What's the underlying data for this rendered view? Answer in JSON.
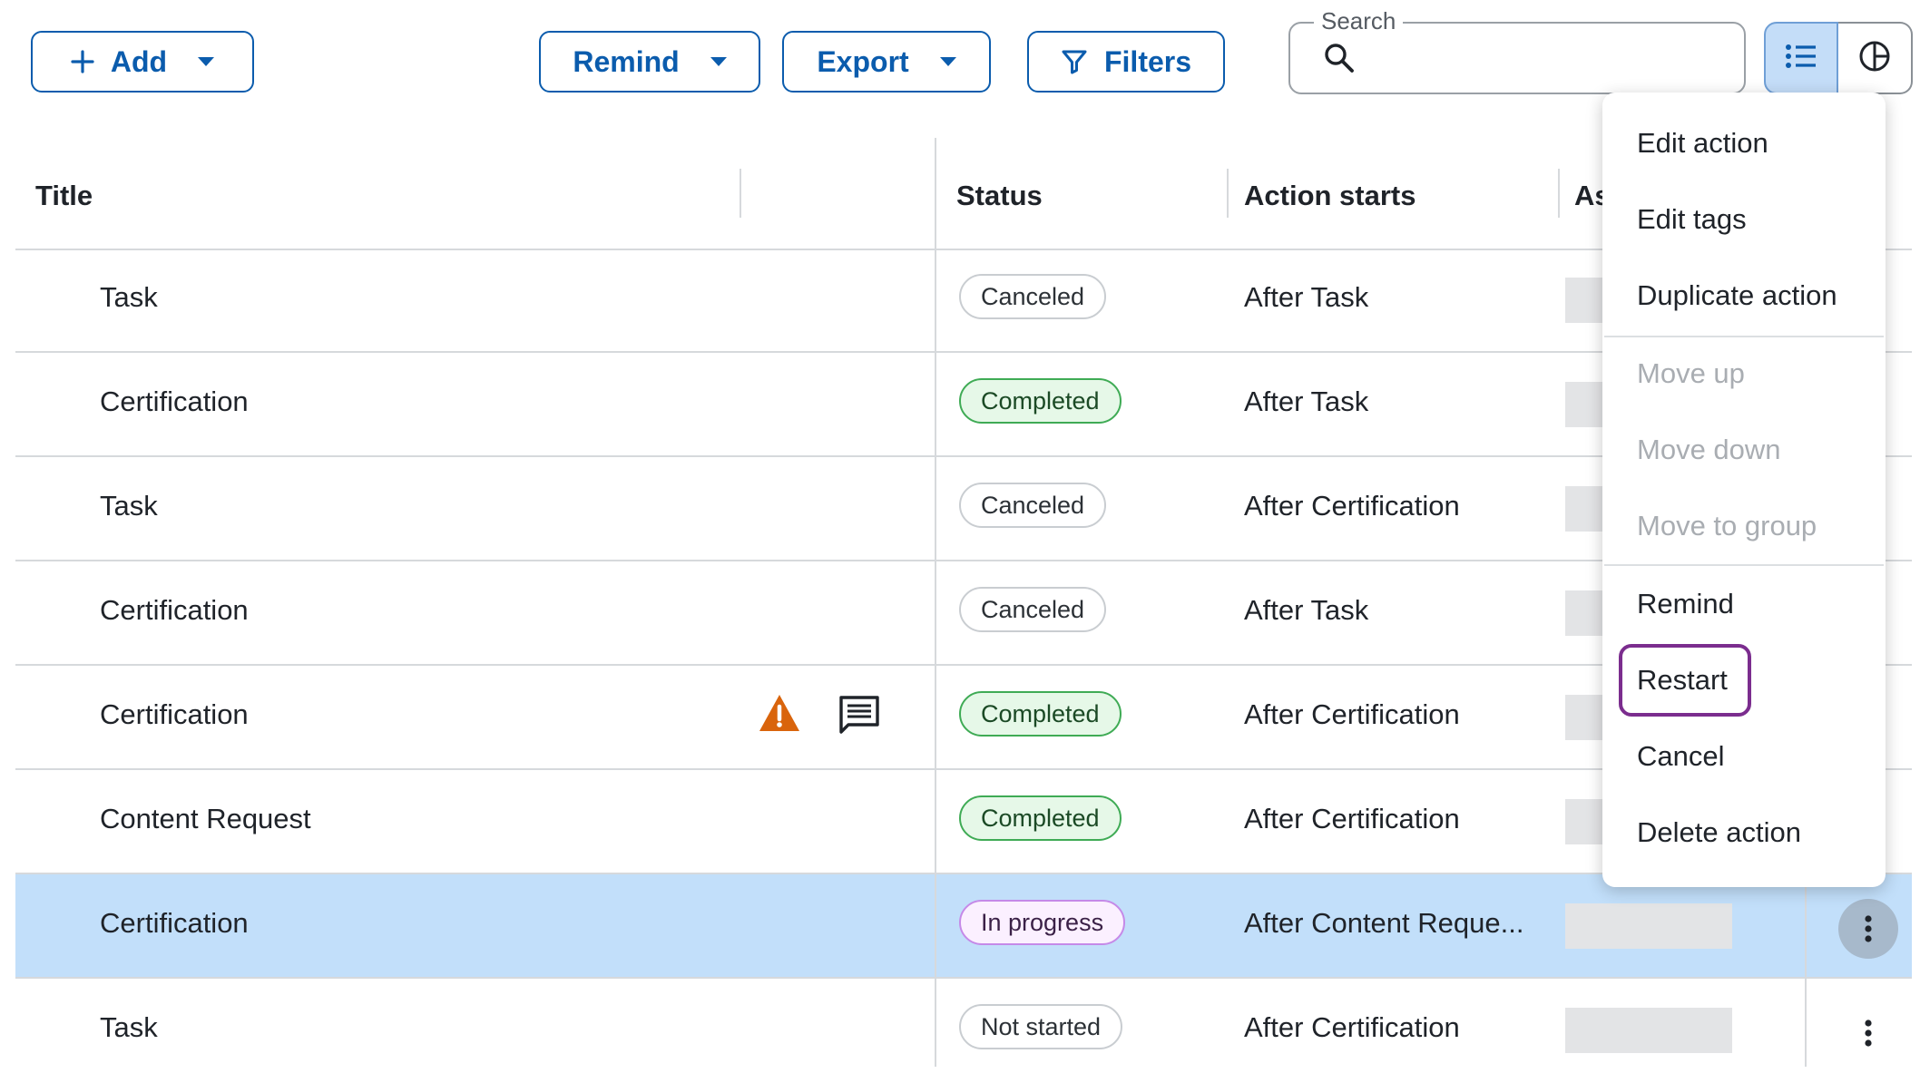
{
  "toolbar": {
    "add_label": "Add",
    "remind_label": "Remind",
    "export_label": "Export",
    "filters_label": "Filters"
  },
  "search": {
    "label": "Search",
    "value": "",
    "placeholder": ""
  },
  "colors": {
    "brand_blue": "#0b5cad",
    "selected_row": "#c2dffa",
    "completed_border": "#3fab55",
    "inprogress_border": "#c58ae8",
    "focus_ring": "#7b2d8e"
  },
  "table": {
    "columns": [
      "Title",
      "Status",
      "Action starts",
      "As"
    ],
    "rows": [
      {
        "title": "Task",
        "status": "Canceled",
        "action_starts": "After Task"
      },
      {
        "title": "Certification",
        "status": "Completed",
        "action_starts": "After Task"
      },
      {
        "title": "Task",
        "status": "Canceled",
        "action_starts": "After Certification"
      },
      {
        "title": "Certification",
        "status": "Canceled",
        "action_starts": "After Task"
      },
      {
        "title": "Certification",
        "status": "Completed",
        "action_starts": "After Certification"
      },
      {
        "title": "Content Request",
        "status": "Completed",
        "action_starts": "After Certification"
      },
      {
        "title": "Certification",
        "status": "In progress",
        "action_starts": "After Content Reque..."
      },
      {
        "title": "Task",
        "status": "Not started",
        "action_starts": "After Certification"
      }
    ]
  },
  "menu": {
    "items": [
      {
        "label": "Edit action"
      },
      {
        "label": "Edit tags"
      },
      {
        "label": "Duplicate action"
      },
      {
        "label": "Move up"
      },
      {
        "label": "Move down"
      },
      {
        "label": "Move to group"
      },
      {
        "label": "Remind"
      },
      {
        "label": "Restart"
      },
      {
        "label": "Cancel"
      },
      {
        "label": "Delete action"
      }
    ]
  }
}
